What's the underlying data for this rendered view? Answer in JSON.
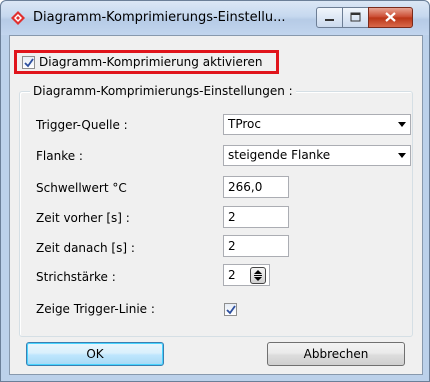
{
  "window": {
    "title": "Diagramm-Komprimierungs-Einstellu..."
  },
  "main_checkbox": {
    "label": "Diagramm-Komprimierung aktivieren",
    "checked": true
  },
  "group": {
    "title": "Diagramm-Komprimierungs-Einstellungen :"
  },
  "fields": {
    "trigger_source": {
      "label": "Trigger-Quelle :",
      "value": "TProc"
    },
    "edge": {
      "label": "Flanke :",
      "value": "steigende Flanke"
    },
    "threshold": {
      "label": "Schwellwert °C",
      "value": "266,0"
    },
    "time_before": {
      "label": "Zeit vorher [s] :",
      "value": "2"
    },
    "time_after": {
      "label": "Zeit danach [s] :",
      "value": "2"
    },
    "line_width": {
      "label": "Strichstärke :",
      "value": "2"
    },
    "show_trigger_line": {
      "label": "Zeige Trigger-Linie :",
      "checked": true
    }
  },
  "buttons": {
    "ok": "OK",
    "cancel": "Abbrechen"
  },
  "colors": {
    "highlight_border": "#e0141b",
    "title_gradient": "#c6d8ef",
    "close_button": "#c9462c"
  },
  "icons": [
    "app-diamond-icon",
    "minimize-icon",
    "maximize-icon",
    "close-icon",
    "checkmark-icon",
    "dropdown-arrow-icon",
    "spin-updown-icon"
  ]
}
